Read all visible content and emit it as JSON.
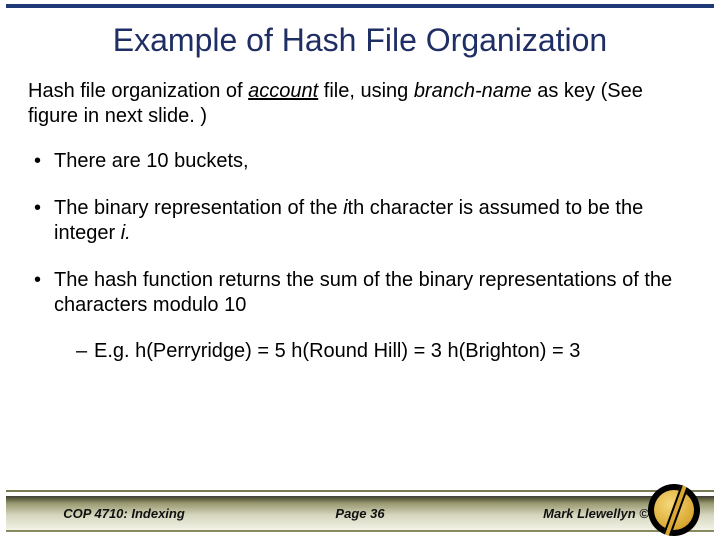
{
  "title": "Example of Hash File Organization",
  "intro": {
    "pre": "Hash file organization of ",
    "acct": "account",
    "mid": " file, using ",
    "key": "branch-name",
    "post": " as key (See figure in next slide. )"
  },
  "bullets": {
    "b1": "There are 10 buckets,",
    "b2_pre": "The binary representation of the ",
    "b2_i": "i",
    "b2_mid": "th character is assumed to be the integer ",
    "b2_i2": "i.",
    "b3": "The hash function returns the sum of the binary representations of the characters modulo 10"
  },
  "sub": "E.g. h(Perryridge) = 5    h(Round Hill) = 3   h(Brighton) = 3",
  "footer": {
    "left": "COP 4710: Indexing",
    "center": "Page 36",
    "right": "Mark Llewellyn ©"
  }
}
